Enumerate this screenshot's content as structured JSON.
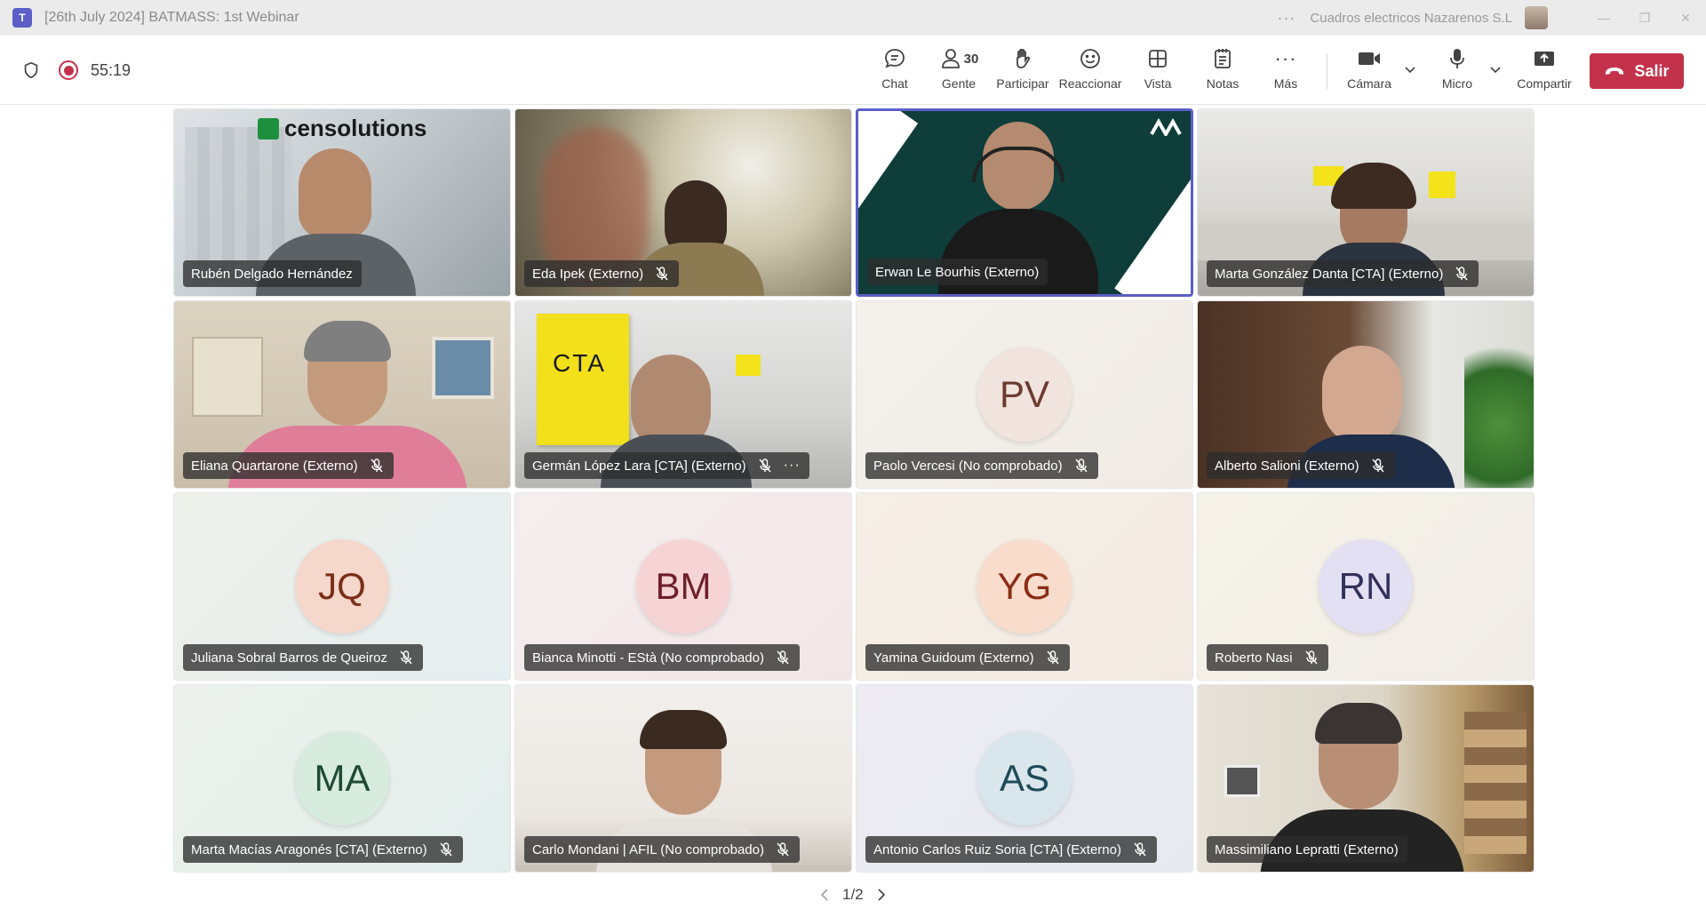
{
  "window": {
    "title": "[26th July 2024] BATMASS: 1st Webinar",
    "org": "Cuadros electricos Nazarenos S.L",
    "ellipsis": "···"
  },
  "meeting": {
    "timer": "55:19"
  },
  "toolbar": {
    "chat": "Chat",
    "people": "Gente",
    "people_count": "30",
    "raise": "Participar",
    "react": "Reaccionar",
    "view": "Vista",
    "notes": "Notas",
    "more": "Más",
    "camera": "Cámara",
    "mic": "Micro",
    "share": "Compartir",
    "leave": "Salir"
  },
  "participants": [
    {
      "name": "Rubén Delgado Hernández",
      "muted": false,
      "video": true,
      "logo_text": "censolutions"
    },
    {
      "name": "Eda Ipek (Externo)",
      "muted": true,
      "video": true
    },
    {
      "name": "Erwan Le Bourhis (Externo)",
      "muted": false,
      "video": true,
      "active": true
    },
    {
      "name": "Marta González Danta [CTA] (Externo)",
      "muted": true,
      "video": true
    },
    {
      "name": "Eliana Quartarone (Externo)",
      "muted": true,
      "video": true
    },
    {
      "name": "Germán López Lara [CTA] (Externo)",
      "muted": true,
      "video": true,
      "sign_text": "CTA"
    },
    {
      "name": "Paolo Vercesi (No comprobado)",
      "muted": true,
      "video": false,
      "initials": "PV",
      "avatar_bg": "#f1e3de",
      "avatar_fg": "#6b3a2e"
    },
    {
      "name": "Alberto Salioni (Externo)",
      "muted": true,
      "video": true
    },
    {
      "name": "Juliana Sobral Barros de Queiroz",
      "muted": true,
      "video": false,
      "initials": "JQ",
      "avatar_bg": "#f6d7cc",
      "avatar_fg": "#7a2e16"
    },
    {
      "name": "Bianca Minotti - EStà (No comprobado)",
      "muted": true,
      "video": false,
      "initials": "BM",
      "avatar_bg": "#f6d4d6",
      "avatar_fg": "#6e1f2a"
    },
    {
      "name": "Yamina Guidoum (Externo)",
      "muted": true,
      "video": false,
      "initials": "YG",
      "avatar_bg": "#f9dccc",
      "avatar_fg": "#8a2c15"
    },
    {
      "name": "Roberto Nasi",
      "muted": true,
      "video": false,
      "initials": "RN",
      "avatar_bg": "#e2e0f2",
      "avatar_fg": "#33305e"
    },
    {
      "name": "Marta Macías Aragonés [CTA] (Externo)",
      "muted": true,
      "video": false,
      "initials": "MA",
      "avatar_bg": "#d7ebdf",
      "avatar_fg": "#1f4a33"
    },
    {
      "name": "Carlo Mondani | AFIL (No comprobado)",
      "muted": true,
      "video": true
    },
    {
      "name": "Antonio Carlos Ruiz Soria [CTA] (Externo)",
      "muted": true,
      "video": false,
      "initials": "AS",
      "avatar_bg": "#d9e7ec",
      "avatar_fg": "#1f4a5a"
    },
    {
      "name": "Massimiliano Lepratti (Externo)",
      "muted": false,
      "video": true
    }
  ],
  "pager": {
    "label": "1/2"
  },
  "colors": {
    "accent": "#5b5fc7",
    "leave": "#c4314b",
    "record": "#c4314b"
  }
}
